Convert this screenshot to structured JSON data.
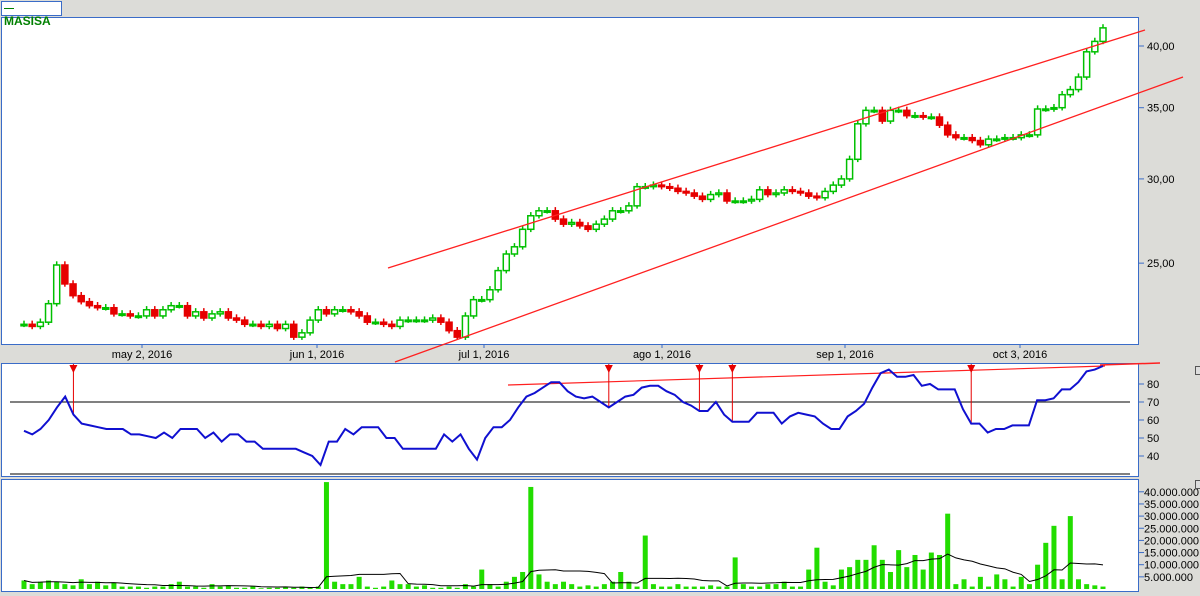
{
  "legend": {
    "symbol": "MASISA"
  },
  "colors": {
    "up": "#00c000",
    "down": "#e60000",
    "trend": "#ff2020",
    "rsi": "#1010d0",
    "volume": "#22dd00",
    "border": "#3a6cc8"
  },
  "chart_data": [
    {
      "type": "candlestick",
      "title": "MASISA",
      "y_scale": "log",
      "y_ticks": [
        "40,00",
        "35,00",
        "30,00",
        "25,00"
      ],
      "y_tick_values": [
        40,
        35,
        30,
        25
      ],
      "x_ticks": [
        "may 2, 2016",
        "jun 1, 2016",
        "jul 1, 2016",
        "ago 1, 2016",
        "sep 1, 2016",
        "oct 3, 2016"
      ],
      "closes": [
        21.9,
        21.8,
        22.0,
        22.9,
        24.9,
        23.9,
        23.3,
        23.0,
        22.8,
        22.7,
        22.7,
        22.4,
        22.4,
        22.3,
        22.3,
        22.6,
        22.3,
        22.6,
        22.8,
        22.8,
        22.3,
        22.5,
        22.2,
        22.4,
        22.5,
        22.2,
        22.1,
        21.9,
        21.9,
        21.8,
        21.9,
        21.7,
        21.9,
        21.3,
        21.5,
        22.1,
        22.6,
        22.4,
        22.6,
        22.6,
        22.5,
        22.3,
        22.0,
        22.0,
        21.9,
        21.8,
        22.1,
        22.1,
        22.1,
        22.1,
        22.2,
        22.0,
        21.6,
        21.3,
        22.3,
        23.1,
        23.1,
        23.6,
        24.6,
        25.5,
        25.9,
        26.9,
        27.7,
        28.0,
        28.0,
        27.5,
        27.2,
        27.3,
        27.1,
        26.9,
        27.2,
        27.5,
        28.0,
        28.0,
        28.3,
        29.5,
        29.5,
        29.6,
        29.5,
        29.4,
        29.2,
        29.1,
        28.9,
        28.7,
        29.0,
        29.1,
        28.6,
        28.6,
        28.6,
        28.7,
        29.3,
        29.0,
        29.1,
        29.3,
        29.2,
        29.1,
        28.9,
        28.8,
        29.2,
        29.6,
        30.0,
        31.3,
        33.8,
        34.8,
        34.8,
        34.0,
        34.8,
        34.8,
        34.4,
        34.4,
        34.3,
        34.3,
        33.7,
        33.0,
        32.8,
        32.8,
        32.6,
        32.3,
        32.7,
        32.7,
        32.8,
        32.8,
        33.0,
        33.0,
        34.9,
        34.9,
        35.0,
        36.0,
        36.4,
        37.4,
        39.5,
        40.4,
        41.6
      ],
      "trendlines": [
        {
          "name": "channel-upper",
          "from": [
            64,
            24.8
          ],
          "to": [
            133,
            41.2
          ]
        },
        {
          "name": "channel-lower",
          "from": [
            45,
            20.5
          ],
          "to": [
            137,
            36.6
          ]
        }
      ]
    },
    {
      "type": "line",
      "title": "RSI",
      "y_ticks": [
        "80",
        "70",
        "60",
        "50",
        "40"
      ],
      "y_tick_values": [
        80,
        70,
        60,
        50,
        40
      ],
      "levels": [
        70,
        30
      ],
      "values": [
        54,
        52,
        55,
        60,
        67,
        73,
        63,
        58,
        57,
        56,
        55,
        55,
        55,
        52,
        52,
        51,
        50,
        53,
        50,
        55,
        55,
        55,
        50,
        53,
        48,
        52,
        52,
        48,
        48,
        44,
        44,
        44,
        44,
        44,
        42,
        40,
        35,
        48,
        48,
        55,
        52,
        56,
        56,
        56,
        50,
        50,
        44,
        44,
        44,
        44,
        44,
        52,
        48,
        52,
        44,
        38,
        50,
        56,
        56,
        60,
        67,
        73,
        75,
        78,
        81,
        81,
        76,
        73,
        72,
        73,
        70,
        67,
        70,
        73,
        74,
        78,
        79,
        79,
        76,
        74,
        70,
        68,
        65,
        65,
        70,
        63,
        59,
        59,
        59,
        64,
        64,
        64,
        58,
        62,
        64,
        63,
        62,
        58,
        55,
        55,
        62,
        65,
        69,
        78,
        86,
        88,
        84,
        84,
        85,
        79,
        80,
        77,
        77,
        77,
        66,
        58,
        58,
        53,
        55,
        55,
        57,
        57,
        57,
        71,
        71,
        72,
        77,
        77,
        81,
        87,
        88,
        90
      ],
      "signal_indices": [
        6,
        71,
        82,
        86,
        115
      ]
    },
    {
      "type": "bar",
      "title": "Volume",
      "y_ticks": [
        "40.000.000",
        "35.000.000",
        "30.000.000",
        "25.000.000",
        "20.000.000",
        "15.000.000",
        "10.000.000",
        "5.000.000"
      ],
      "y_tick_values": [
        40,
        35,
        30,
        25,
        20,
        15,
        10,
        5
      ],
      "unit": "millions",
      "values": [
        3.5,
        2,
        3,
        3.5,
        3,
        2,
        1.5,
        4,
        2,
        3,
        1.5,
        2.5,
        1,
        1,
        1,
        0.5,
        1,
        1,
        2,
        3,
        1,
        1,
        0.5,
        2,
        1,
        1.5,
        0.5,
        0.5,
        1,
        0.3,
        0.5,
        0.5,
        1,
        0.5,
        1,
        0.5,
        1,
        44,
        3,
        2,
        2,
        5,
        1,
        0.5,
        1,
        3.5,
        2,
        2,
        1,
        1.5,
        0.5,
        0.5,
        1,
        0.5,
        2,
        1,
        8,
        2,
        1,
        3,
        5,
        7,
        42,
        6,
        3,
        2,
        3,
        2,
        1,
        1.5,
        1,
        2,
        3,
        7,
        3,
        1,
        22,
        2,
        1,
        1,
        2,
        1,
        1,
        1,
        1.5,
        1,
        1,
        13,
        2,
        1,
        1,
        2,
        2,
        3,
        1,
        1,
        8,
        17,
        3,
        1.5,
        8,
        9,
        12,
        12,
        18,
        12,
        7,
        16,
        9,
        14,
        8,
        15,
        14,
        31,
        2,
        4,
        1,
        5,
        1,
        6,
        4,
        1,
        5,
        2,
        10,
        19,
        26,
        4,
        30,
        4,
        2,
        1.5,
        1
      ]
    }
  ]
}
